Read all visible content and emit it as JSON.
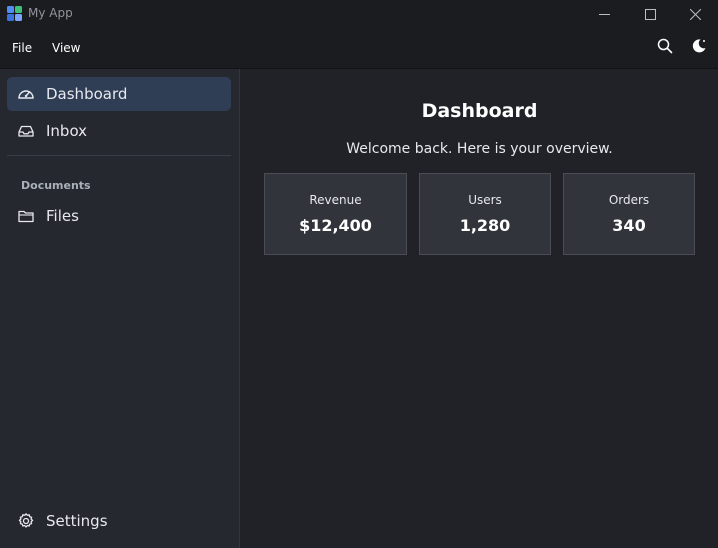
{
  "window": {
    "title": "My App",
    "logo_icon": "app-grid-logo",
    "controls": [
      "minimize",
      "maximize",
      "close"
    ]
  },
  "menubar": {
    "items": [
      {
        "label": "File"
      },
      {
        "label": "View"
      }
    ],
    "actions": [
      {
        "icon": "search-icon"
      },
      {
        "icon": "theme-toggle-icon"
      }
    ]
  },
  "sidebar": {
    "items": [
      {
        "label": "Dashboard",
        "icon": "gauge-icon",
        "active": true
      },
      {
        "label": "Inbox",
        "icon": "inbox-icon",
        "active": false
      }
    ],
    "section": {
      "label": "Documents",
      "items": [
        {
          "label": "Files",
          "icon": "folder-icon"
        }
      ]
    },
    "footer": {
      "label": "Settings",
      "icon": "gear-icon"
    }
  },
  "main": {
    "title": "Dashboard",
    "subtitle": "Welcome back. Here is your overview.",
    "stats": [
      {
        "label": "Revenue",
        "value": "$12,400"
      },
      {
        "label": "Users",
        "value": "1,280"
      },
      {
        "label": "Orders",
        "value": "340"
      }
    ]
  },
  "colors": {
    "titlebar_bg": "#1a1c20",
    "sidebar_bg": "#25282f",
    "main_bg": "#202227",
    "active_item_bg": "#2f3d55",
    "card_bg": "#31343b",
    "card_border": "#4a4d55"
  }
}
